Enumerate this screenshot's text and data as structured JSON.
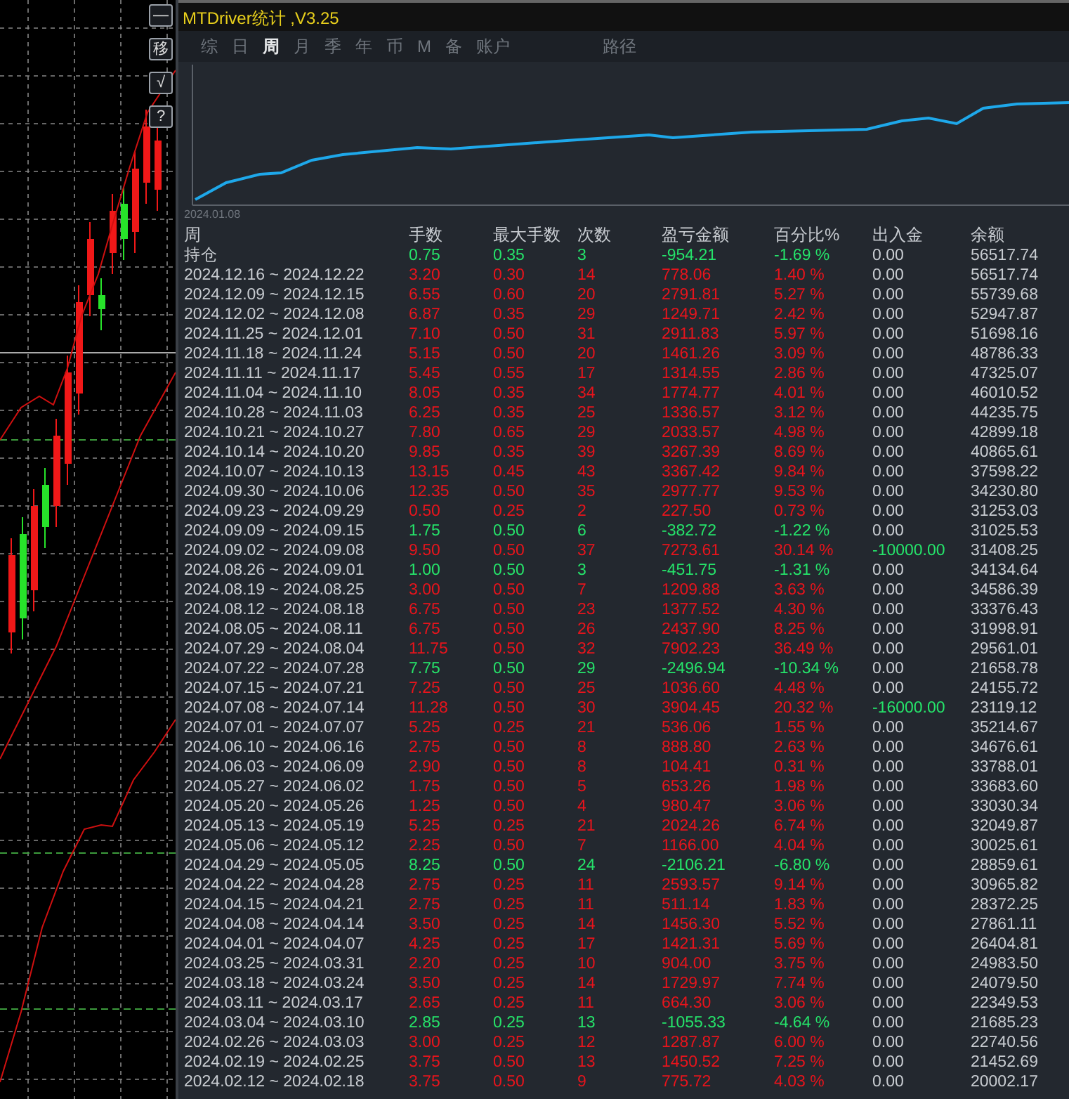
{
  "side_buttons": [
    "—",
    "移",
    "√",
    "?"
  ],
  "window": {
    "title": "MTDriver统计 ,V3.25"
  },
  "tabs": [
    {
      "label": "综",
      "selected": false
    },
    {
      "label": "日",
      "selected": false
    },
    {
      "label": "周",
      "selected": true
    },
    {
      "label": "月",
      "selected": false
    },
    {
      "label": "季",
      "selected": false
    },
    {
      "label": "年",
      "selected": false
    },
    {
      "label": "币",
      "selected": false
    },
    {
      "label": "M",
      "selected": false
    },
    {
      "label": "备",
      "selected": false
    },
    {
      "label": "账户",
      "selected": false
    },
    {
      "label": "路径",
      "selected": false
    }
  ],
  "equity_chart": {
    "start_label": "2024.01.08"
  },
  "table": {
    "columns": [
      "周",
      "手数",
      "最大手数",
      "次数",
      "盈亏金额",
      "百分比%",
      "出入金",
      "余额"
    ],
    "rows": [
      {
        "period": "持仓",
        "lots": "0.75",
        "max_lots": "0.35",
        "trades": "3",
        "pnl": "-954.21",
        "pct": "-1.69 %",
        "flow": "0.00",
        "balance": "56517.74",
        "kind": "loss",
        "flow_highlight": false
      },
      {
        "period": "2024.12.16 ~ 2024.12.22",
        "lots": "3.20",
        "max_lots": "0.30",
        "trades": "14",
        "pnl": "778.06",
        "pct": "1.40 %",
        "flow": "0.00",
        "balance": "56517.74",
        "kind": "gain",
        "flow_highlight": false
      },
      {
        "period": "2024.12.09 ~ 2024.12.15",
        "lots": "6.55",
        "max_lots": "0.60",
        "trades": "20",
        "pnl": "2791.81",
        "pct": "5.27 %",
        "flow": "0.00",
        "balance": "55739.68",
        "kind": "gain",
        "flow_highlight": false
      },
      {
        "period": "2024.12.02 ~ 2024.12.08",
        "lots": "6.87",
        "max_lots": "0.35",
        "trades": "29",
        "pnl": "1249.71",
        "pct": "2.42 %",
        "flow": "0.00",
        "balance": "52947.87",
        "kind": "gain",
        "flow_highlight": false
      },
      {
        "period": "2024.11.25 ~ 2024.12.01",
        "lots": "7.10",
        "max_lots": "0.50",
        "trades": "31",
        "pnl": "2911.83",
        "pct": "5.97 %",
        "flow": "0.00",
        "balance": "51698.16",
        "kind": "gain",
        "flow_highlight": false
      },
      {
        "period": "2024.11.18 ~ 2024.11.24",
        "lots": "5.15",
        "max_lots": "0.50",
        "trades": "20",
        "pnl": "1461.26",
        "pct": "3.09 %",
        "flow": "0.00",
        "balance": "48786.33",
        "kind": "gain",
        "flow_highlight": false
      },
      {
        "period": "2024.11.11 ~ 2024.11.17",
        "lots": "5.45",
        "max_lots": "0.55",
        "trades": "17",
        "pnl": "1314.55",
        "pct": "2.86 %",
        "flow": "0.00",
        "balance": "47325.07",
        "kind": "gain",
        "flow_highlight": false
      },
      {
        "period": "2024.11.04 ~ 2024.11.10",
        "lots": "8.05",
        "max_lots": "0.35",
        "trades": "34",
        "pnl": "1774.77",
        "pct": "4.01 %",
        "flow": "0.00",
        "balance": "46010.52",
        "kind": "gain",
        "flow_highlight": false
      },
      {
        "period": "2024.10.28 ~ 2024.11.03",
        "lots": "6.25",
        "max_lots": "0.35",
        "trades": "25",
        "pnl": "1336.57",
        "pct": "3.12 %",
        "flow": "0.00",
        "balance": "44235.75",
        "kind": "gain",
        "flow_highlight": false
      },
      {
        "period": "2024.10.21 ~ 2024.10.27",
        "lots": "7.80",
        "max_lots": "0.65",
        "trades": "29",
        "pnl": "2033.57",
        "pct": "4.98 %",
        "flow": "0.00",
        "balance": "42899.18",
        "kind": "gain",
        "flow_highlight": false
      },
      {
        "period": "2024.10.14 ~ 2024.10.20",
        "lots": "9.85",
        "max_lots": "0.35",
        "trades": "39",
        "pnl": "3267.39",
        "pct": "8.69 %",
        "flow": "0.00",
        "balance": "40865.61",
        "kind": "gain",
        "flow_highlight": false
      },
      {
        "period": "2024.10.07 ~ 2024.10.13",
        "lots": "13.15",
        "max_lots": "0.45",
        "trades": "43",
        "pnl": "3367.42",
        "pct": "9.84 %",
        "flow": "0.00",
        "balance": "37598.22",
        "kind": "gain",
        "flow_highlight": false
      },
      {
        "period": "2024.09.30 ~ 2024.10.06",
        "lots": "12.35",
        "max_lots": "0.50",
        "trades": "35",
        "pnl": "2977.77",
        "pct": "9.53 %",
        "flow": "0.00",
        "balance": "34230.80",
        "kind": "gain",
        "flow_highlight": false
      },
      {
        "period": "2024.09.23 ~ 2024.09.29",
        "lots": "0.50",
        "max_lots": "0.25",
        "trades": "2",
        "pnl": "227.50",
        "pct": "0.73 %",
        "flow": "0.00",
        "balance": "31253.03",
        "kind": "gain",
        "flow_highlight": false
      },
      {
        "period": "2024.09.09 ~ 2024.09.15",
        "lots": "1.75",
        "max_lots": "0.50",
        "trades": "6",
        "pnl": "-382.72",
        "pct": "-1.22 %",
        "flow": "0.00",
        "balance": "31025.53",
        "kind": "loss",
        "flow_highlight": false
      },
      {
        "period": "2024.09.02 ~ 2024.09.08",
        "lots": "9.50",
        "max_lots": "0.50",
        "trades": "37",
        "pnl": "7273.61",
        "pct": "30.14 %",
        "flow": "-10000.00",
        "balance": "31408.25",
        "kind": "gain",
        "flow_highlight": true
      },
      {
        "period": "2024.08.26 ~ 2024.09.01",
        "lots": "1.00",
        "max_lots": "0.50",
        "trades": "3",
        "pnl": "-451.75",
        "pct": "-1.31 %",
        "flow": "0.00",
        "balance": "34134.64",
        "kind": "loss",
        "flow_highlight": false
      },
      {
        "period": "2024.08.19 ~ 2024.08.25",
        "lots": "3.00",
        "max_lots": "0.50",
        "trades": "7",
        "pnl": "1209.88",
        "pct": "3.63 %",
        "flow": "0.00",
        "balance": "34586.39",
        "kind": "gain",
        "flow_highlight": false
      },
      {
        "period": "2024.08.12 ~ 2024.08.18",
        "lots": "6.75",
        "max_lots": "0.50",
        "trades": "23",
        "pnl": "1377.52",
        "pct": "4.30 %",
        "flow": "0.00",
        "balance": "33376.43",
        "kind": "gain",
        "flow_highlight": false
      },
      {
        "period": "2024.08.05 ~ 2024.08.11",
        "lots": "6.75",
        "max_lots": "0.50",
        "trades": "26",
        "pnl": "2437.90",
        "pct": "8.25 %",
        "flow": "0.00",
        "balance": "31998.91",
        "kind": "gain",
        "flow_highlight": false
      },
      {
        "period": "2024.07.29 ~ 2024.08.04",
        "lots": "11.75",
        "max_lots": "0.50",
        "trades": "32",
        "pnl": "7902.23",
        "pct": "36.49 %",
        "flow": "0.00",
        "balance": "29561.01",
        "kind": "gain",
        "flow_highlight": false
      },
      {
        "period": "2024.07.22 ~ 2024.07.28",
        "lots": "7.75",
        "max_lots": "0.50",
        "trades": "29",
        "pnl": "-2496.94",
        "pct": "-10.34 %",
        "flow": "0.00",
        "balance": "21658.78",
        "kind": "loss",
        "flow_highlight": false
      },
      {
        "period": "2024.07.15 ~ 2024.07.21",
        "lots": "7.25",
        "max_lots": "0.50",
        "trades": "25",
        "pnl": "1036.60",
        "pct": "4.48 %",
        "flow": "0.00",
        "balance": "24155.72",
        "kind": "gain",
        "flow_highlight": false
      },
      {
        "period": "2024.07.08 ~ 2024.07.14",
        "lots": "11.28",
        "max_lots": "0.50",
        "trades": "30",
        "pnl": "3904.45",
        "pct": "20.32 %",
        "flow": "-16000.00",
        "balance": "23119.12",
        "kind": "gain",
        "flow_highlight": true
      },
      {
        "period": "2024.07.01 ~ 2024.07.07",
        "lots": "5.25",
        "max_lots": "0.25",
        "trades": "21",
        "pnl": "536.06",
        "pct": "1.55 %",
        "flow": "0.00",
        "balance": "35214.67",
        "kind": "gain",
        "flow_highlight": false
      },
      {
        "period": "2024.06.10 ~ 2024.06.16",
        "lots": "2.75",
        "max_lots": "0.50",
        "trades": "8",
        "pnl": "888.80",
        "pct": "2.63 %",
        "flow": "0.00",
        "balance": "34676.61",
        "kind": "gain",
        "flow_highlight": false
      },
      {
        "period": "2024.06.03 ~ 2024.06.09",
        "lots": "2.90",
        "max_lots": "0.50",
        "trades": "8",
        "pnl": "104.41",
        "pct": "0.31 %",
        "flow": "0.00",
        "balance": "33788.01",
        "kind": "gain",
        "flow_highlight": false
      },
      {
        "period": "2024.05.27 ~ 2024.06.02",
        "lots": "1.75",
        "max_lots": "0.50",
        "trades": "5",
        "pnl": "653.26",
        "pct": "1.98 %",
        "flow": "0.00",
        "balance": "33683.60",
        "kind": "gain",
        "flow_highlight": false
      },
      {
        "period": "2024.05.20 ~ 2024.05.26",
        "lots": "1.25",
        "max_lots": "0.50",
        "trades": "4",
        "pnl": "980.47",
        "pct": "3.06 %",
        "flow": "0.00",
        "balance": "33030.34",
        "kind": "gain",
        "flow_highlight": false
      },
      {
        "period": "2024.05.13 ~ 2024.05.19",
        "lots": "5.25",
        "max_lots": "0.25",
        "trades": "21",
        "pnl": "2024.26",
        "pct": "6.74 %",
        "flow": "0.00",
        "balance": "32049.87",
        "kind": "gain",
        "flow_highlight": false
      },
      {
        "period": "2024.05.06 ~ 2024.05.12",
        "lots": "2.25",
        "max_lots": "0.50",
        "trades": "7",
        "pnl": "1166.00",
        "pct": "4.04 %",
        "flow": "0.00",
        "balance": "30025.61",
        "kind": "gain",
        "flow_highlight": false
      },
      {
        "period": "2024.04.29 ~ 2024.05.05",
        "lots": "8.25",
        "max_lots": "0.50",
        "trades": "24",
        "pnl": "-2106.21",
        "pct": "-6.80 %",
        "flow": "0.00",
        "balance": "28859.61",
        "kind": "loss",
        "flow_highlight": false
      },
      {
        "period": "2024.04.22 ~ 2024.04.28",
        "lots": "2.75",
        "max_lots": "0.25",
        "trades": "11",
        "pnl": "2593.57",
        "pct": "9.14 %",
        "flow": "0.00",
        "balance": "30965.82",
        "kind": "gain",
        "flow_highlight": false
      },
      {
        "period": "2024.04.15 ~ 2024.04.21",
        "lots": "2.75",
        "max_lots": "0.25",
        "trades": "11",
        "pnl": "511.14",
        "pct": "1.83 %",
        "flow": "0.00",
        "balance": "28372.25",
        "kind": "gain",
        "flow_highlight": false
      },
      {
        "period": "2024.04.08 ~ 2024.04.14",
        "lots": "3.50",
        "max_lots": "0.25",
        "trades": "14",
        "pnl": "1456.30",
        "pct": "5.52 %",
        "flow": "0.00",
        "balance": "27861.11",
        "kind": "gain",
        "flow_highlight": false
      },
      {
        "period": "2024.04.01 ~ 2024.04.07",
        "lots": "4.25",
        "max_lots": "0.25",
        "trades": "17",
        "pnl": "1421.31",
        "pct": "5.69 %",
        "flow": "0.00",
        "balance": "26404.81",
        "kind": "gain",
        "flow_highlight": false
      },
      {
        "period": "2024.03.25 ~ 2024.03.31",
        "lots": "2.20",
        "max_lots": "0.25",
        "trades": "10",
        "pnl": "904.00",
        "pct": "3.75 %",
        "flow": "0.00",
        "balance": "24983.50",
        "kind": "gain",
        "flow_highlight": false
      },
      {
        "period": "2024.03.18 ~ 2024.03.24",
        "lots": "3.50",
        "max_lots": "0.25",
        "trades": "14",
        "pnl": "1729.97",
        "pct": "7.74 %",
        "flow": "0.00",
        "balance": "24079.50",
        "kind": "gain",
        "flow_highlight": false
      },
      {
        "period": "2024.03.11 ~ 2024.03.17",
        "lots": "2.65",
        "max_lots": "0.25",
        "trades": "11",
        "pnl": "664.30",
        "pct": "3.06 %",
        "flow": "0.00",
        "balance": "22349.53",
        "kind": "gain",
        "flow_highlight": false
      },
      {
        "period": "2024.03.04 ~ 2024.03.10",
        "lots": "2.85",
        "max_lots": "0.25",
        "trades": "13",
        "pnl": "-1055.33",
        "pct": "-4.64 %",
        "flow": "0.00",
        "balance": "21685.23",
        "kind": "loss",
        "flow_highlight": false
      },
      {
        "period": "2024.02.26 ~ 2024.03.03",
        "lots": "3.00",
        "max_lots": "0.25",
        "trades": "12",
        "pnl": "1287.87",
        "pct": "6.00 %",
        "flow": "0.00",
        "balance": "22740.56",
        "kind": "gain",
        "flow_highlight": false
      },
      {
        "period": "2024.02.19 ~ 2024.02.25",
        "lots": "3.75",
        "max_lots": "0.50",
        "trades": "13",
        "pnl": "1450.52",
        "pct": "7.25 %",
        "flow": "0.00",
        "balance": "21452.69",
        "kind": "gain",
        "flow_highlight": false
      },
      {
        "period": "2024.02.12 ~ 2024.02.18",
        "lots": "3.75",
        "max_lots": "0.50",
        "trades": "9",
        "pnl": "775.72",
        "pct": "4.03 %",
        "flow": "0.00",
        "balance": "20002.17",
        "kind": "gain",
        "flow_highlight": false
      }
    ]
  }
}
